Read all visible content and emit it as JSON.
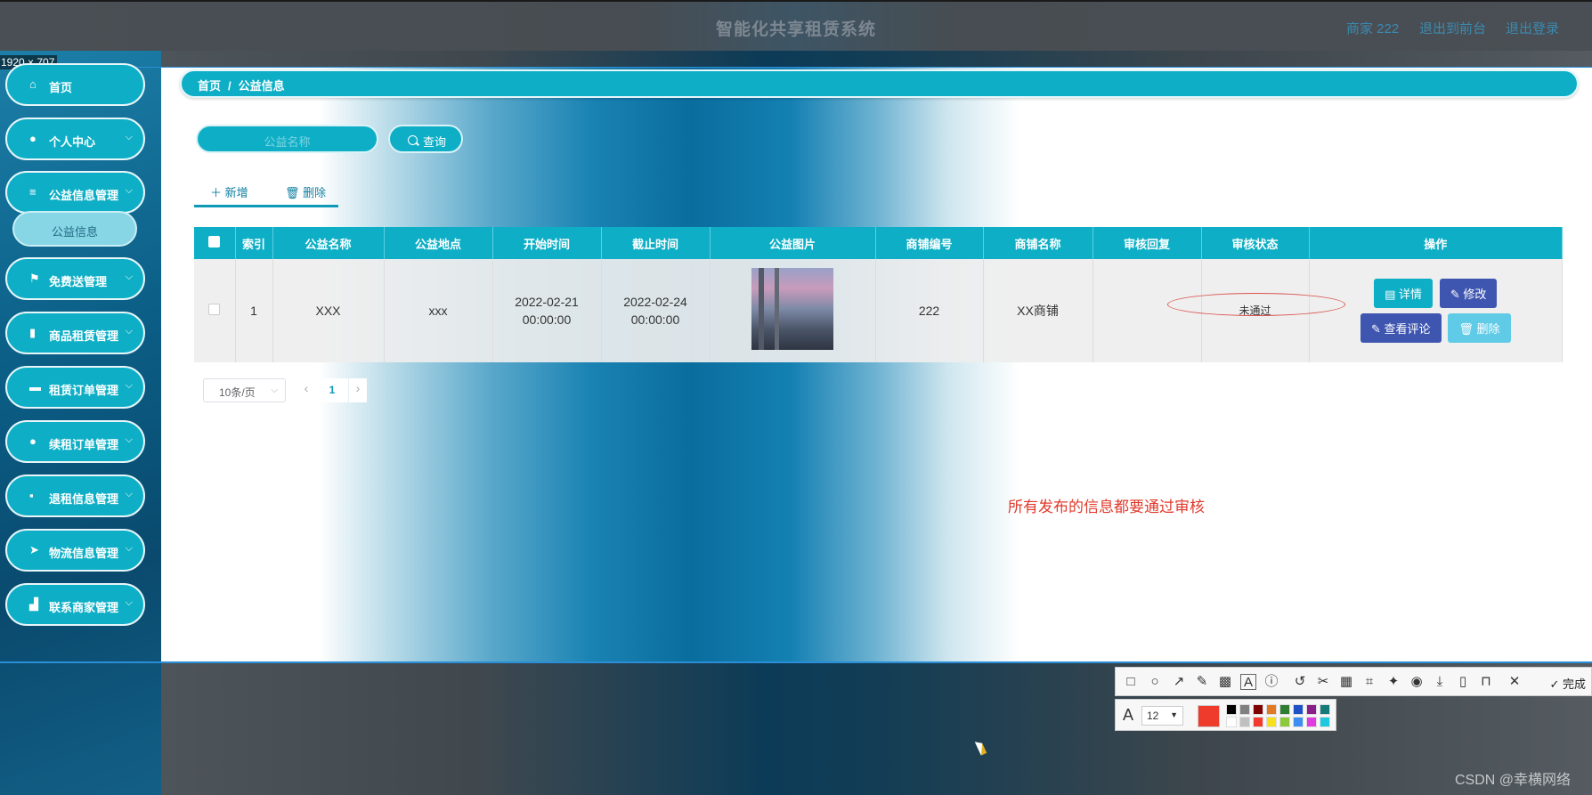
{
  "app_title": "智能化共享租赁系统",
  "top_links": {
    "merchant": "商家 222",
    "to_front": "退出到前台",
    "logout": "退出登录"
  },
  "screen_size_label": "1920 × 707",
  "breadcrumb": {
    "home": "首页",
    "separator": "/",
    "current": "公益信息"
  },
  "search": {
    "placeholder": "公益名称",
    "button_label": "查询"
  },
  "toolbar": {
    "add_label": "新增",
    "delete_label": "删除"
  },
  "sidebar": {
    "items": [
      {
        "label": "首页",
        "icon": "home-icon"
      },
      {
        "label": "个人中心",
        "icon": "user-icon"
      },
      {
        "label": "公益信息管理",
        "icon": "list-icon"
      },
      {
        "label": "免费送管理",
        "icon": "flag-icon"
      },
      {
        "label": "商品租赁管理",
        "icon": "bar-chart-icon"
      },
      {
        "label": "租赁订单管理",
        "icon": "monitor-icon"
      },
      {
        "label": "续租订单管理",
        "icon": "location-icon"
      },
      {
        "label": "退租信息管理",
        "icon": "box-icon"
      },
      {
        "label": "物流信息管理",
        "icon": "send-icon"
      },
      {
        "label": "联系商家管理",
        "icon": "shop-icon"
      }
    ],
    "submenu_label": "公益信息"
  },
  "table": {
    "headers": [
      "索引",
      "公益名称",
      "公益地点",
      "开始时间",
      "截止时间",
      "公益图片",
      "商铺编号",
      "商铺名称",
      "审核回复",
      "审核状态",
      "操作"
    ],
    "rows": [
      {
        "index": "1",
        "name": "XXX",
        "place": "xxx",
        "start_time": "2022-02-21 00:00:00",
        "end_time": "2022-02-24 00:00:00",
        "shop_no": "222",
        "shop_name": "XX商铺",
        "review_reply": "",
        "review_status": "未通过"
      }
    ],
    "actions": {
      "detail": "详情",
      "edit": "修改",
      "view_comments": "查看评论",
      "delete": "删除"
    }
  },
  "pagination": {
    "page_size": "10条/页",
    "current_page": "1"
  },
  "notice": "所有发布的信息都要通过审核",
  "snip_tool": {
    "done_label": "完成",
    "font_size": "12"
  },
  "watermark": "CSDN @幸横网络",
  "colors": {
    "accent": "#0eafc6",
    "indigo": "#3f56b0",
    "alert": "#e03a2c"
  }
}
